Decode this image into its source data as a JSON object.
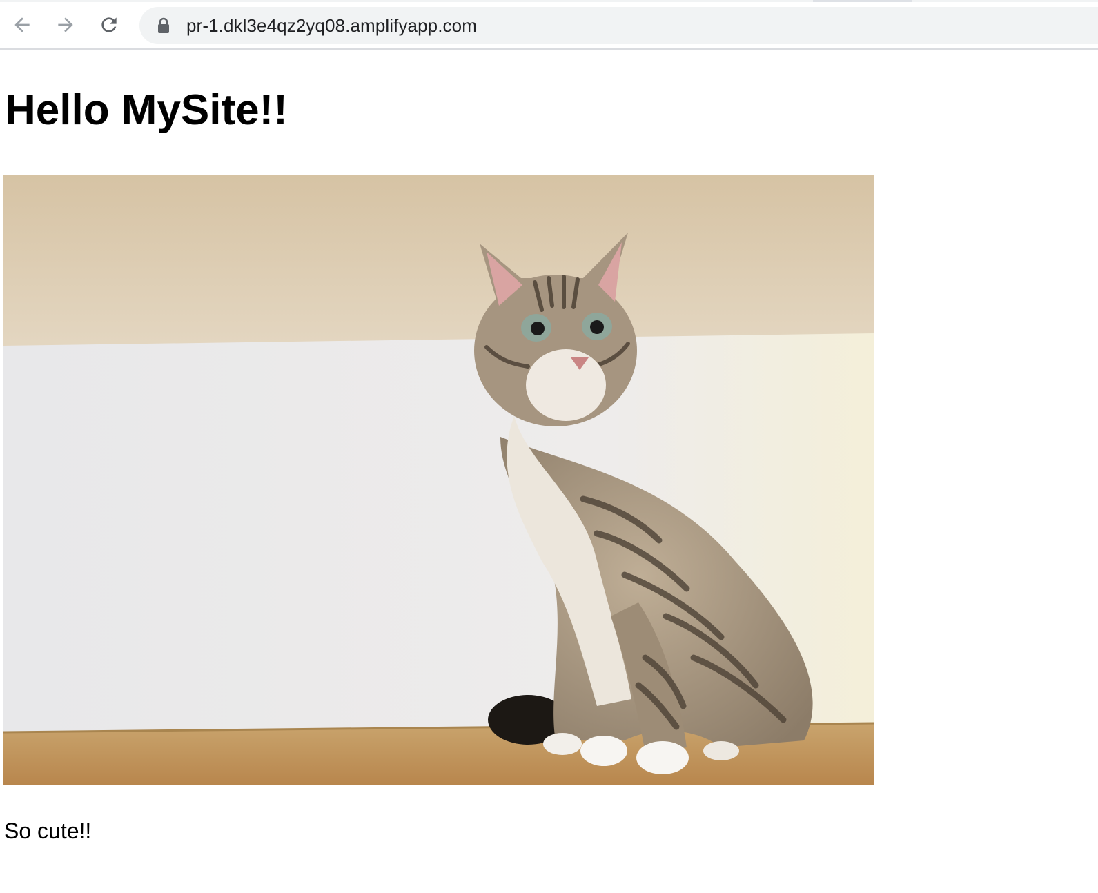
{
  "browser": {
    "address_bar": {
      "url": "pr-1.dkl3e4qz2yq08.amplifyapp.com"
    },
    "icons": {
      "back": "back-arrow-icon",
      "forward": "forward-arrow-icon",
      "reload": "reload-icon",
      "security": "lock-icon"
    }
  },
  "page": {
    "heading": "Hello MySite!!",
    "image": {
      "subject": "tabby cat sitting on a wooden table"
    },
    "caption": "So cute!!"
  }
}
